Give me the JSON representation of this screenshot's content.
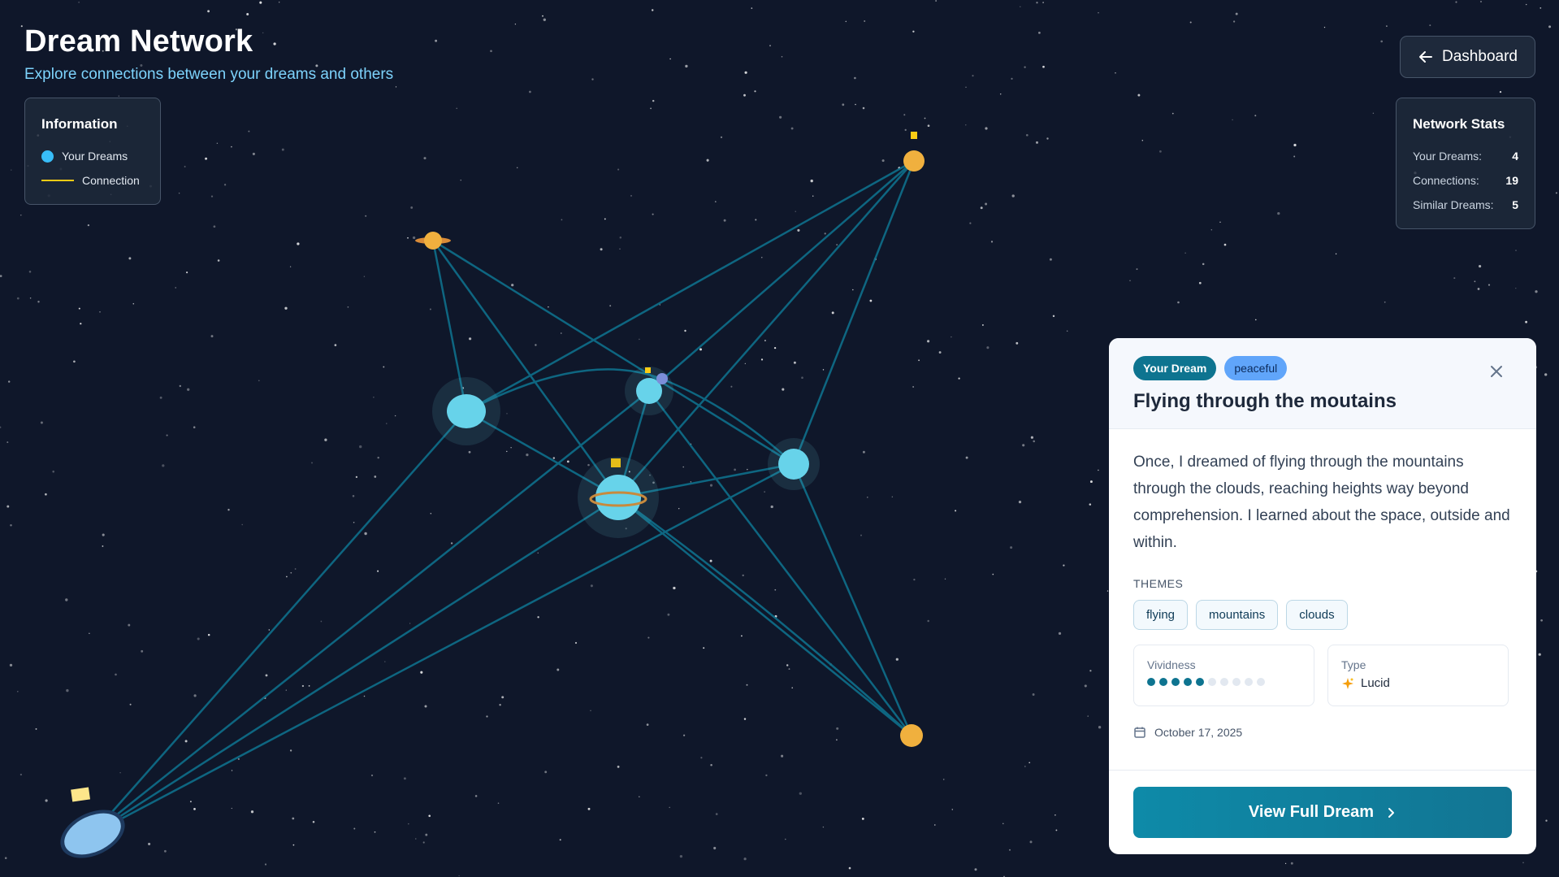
{
  "header": {
    "title": "Dream Network",
    "subtitle": "Explore connections between your dreams and others"
  },
  "info": {
    "title": "Information",
    "legend_dreams": "Your Dreams",
    "legend_connection": "Connection"
  },
  "stats": {
    "title": "Network Stats",
    "rows": [
      {
        "label": "Your Dreams:",
        "value": "4"
      },
      {
        "label": "Connections:",
        "value": "19"
      },
      {
        "label": "Similar Dreams:",
        "value": "5"
      }
    ]
  },
  "nav": {
    "dashboard_label": "Dashboard"
  },
  "card": {
    "badge_owner": "Your Dream",
    "badge_mood": "peaceful",
    "title": "Flying through the moutains",
    "description": "Once, I dreamed of flying through the mountains through the clouds, reaching heights way beyond comprehension. I learned about the space, outside and within.",
    "themes_label": "THEMES",
    "themes": [
      "flying",
      "mountains",
      "clouds"
    ],
    "vividness_label": "Vividness",
    "vividness": 5,
    "vividness_max": 10,
    "type_label": "Type",
    "type_value": "Lucid",
    "date": "October 17, 2025",
    "view_button": "View Full Dream"
  },
  "colors": {
    "background": "#0f172a",
    "accent": "#0e7490",
    "dream_node": "#67d3ea",
    "similar_node": "#f0b03e",
    "connection": "#0e6b86"
  },
  "icons": {
    "back": "arrow-left-icon",
    "close": "close-icon",
    "calendar": "calendar-icon",
    "chevron": "chevron-right-icon",
    "sparkle": "sparkle-icon"
  }
}
